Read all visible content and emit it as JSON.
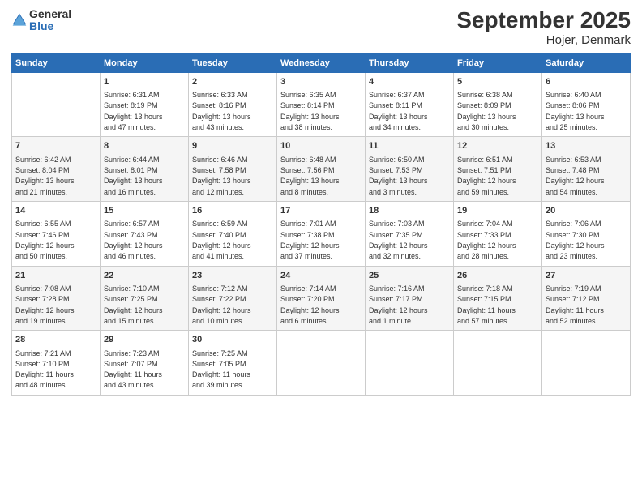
{
  "header": {
    "logo_general": "General",
    "logo_blue": "Blue",
    "title": "September 2025",
    "subtitle": "Hojer, Denmark"
  },
  "days_of_week": [
    "Sunday",
    "Monday",
    "Tuesday",
    "Wednesday",
    "Thursday",
    "Friday",
    "Saturday"
  ],
  "weeks": [
    [
      {
        "day": "",
        "info": ""
      },
      {
        "day": "1",
        "info": "Sunrise: 6:31 AM\nSunset: 8:19 PM\nDaylight: 13 hours\nand 47 minutes."
      },
      {
        "day": "2",
        "info": "Sunrise: 6:33 AM\nSunset: 8:16 PM\nDaylight: 13 hours\nand 43 minutes."
      },
      {
        "day": "3",
        "info": "Sunrise: 6:35 AM\nSunset: 8:14 PM\nDaylight: 13 hours\nand 38 minutes."
      },
      {
        "day": "4",
        "info": "Sunrise: 6:37 AM\nSunset: 8:11 PM\nDaylight: 13 hours\nand 34 minutes."
      },
      {
        "day": "5",
        "info": "Sunrise: 6:38 AM\nSunset: 8:09 PM\nDaylight: 13 hours\nand 30 minutes."
      },
      {
        "day": "6",
        "info": "Sunrise: 6:40 AM\nSunset: 8:06 PM\nDaylight: 13 hours\nand 25 minutes."
      }
    ],
    [
      {
        "day": "7",
        "info": "Sunrise: 6:42 AM\nSunset: 8:04 PM\nDaylight: 13 hours\nand 21 minutes."
      },
      {
        "day": "8",
        "info": "Sunrise: 6:44 AM\nSunset: 8:01 PM\nDaylight: 13 hours\nand 16 minutes."
      },
      {
        "day": "9",
        "info": "Sunrise: 6:46 AM\nSunset: 7:58 PM\nDaylight: 13 hours\nand 12 minutes."
      },
      {
        "day": "10",
        "info": "Sunrise: 6:48 AM\nSunset: 7:56 PM\nDaylight: 13 hours\nand 8 minutes."
      },
      {
        "day": "11",
        "info": "Sunrise: 6:50 AM\nSunset: 7:53 PM\nDaylight: 13 hours\nand 3 minutes."
      },
      {
        "day": "12",
        "info": "Sunrise: 6:51 AM\nSunset: 7:51 PM\nDaylight: 12 hours\nand 59 minutes."
      },
      {
        "day": "13",
        "info": "Sunrise: 6:53 AM\nSunset: 7:48 PM\nDaylight: 12 hours\nand 54 minutes."
      }
    ],
    [
      {
        "day": "14",
        "info": "Sunrise: 6:55 AM\nSunset: 7:46 PM\nDaylight: 12 hours\nand 50 minutes."
      },
      {
        "day": "15",
        "info": "Sunrise: 6:57 AM\nSunset: 7:43 PM\nDaylight: 12 hours\nand 46 minutes."
      },
      {
        "day": "16",
        "info": "Sunrise: 6:59 AM\nSunset: 7:40 PM\nDaylight: 12 hours\nand 41 minutes."
      },
      {
        "day": "17",
        "info": "Sunrise: 7:01 AM\nSunset: 7:38 PM\nDaylight: 12 hours\nand 37 minutes."
      },
      {
        "day": "18",
        "info": "Sunrise: 7:03 AM\nSunset: 7:35 PM\nDaylight: 12 hours\nand 32 minutes."
      },
      {
        "day": "19",
        "info": "Sunrise: 7:04 AM\nSunset: 7:33 PM\nDaylight: 12 hours\nand 28 minutes."
      },
      {
        "day": "20",
        "info": "Sunrise: 7:06 AM\nSunset: 7:30 PM\nDaylight: 12 hours\nand 23 minutes."
      }
    ],
    [
      {
        "day": "21",
        "info": "Sunrise: 7:08 AM\nSunset: 7:28 PM\nDaylight: 12 hours\nand 19 minutes."
      },
      {
        "day": "22",
        "info": "Sunrise: 7:10 AM\nSunset: 7:25 PM\nDaylight: 12 hours\nand 15 minutes."
      },
      {
        "day": "23",
        "info": "Sunrise: 7:12 AM\nSunset: 7:22 PM\nDaylight: 12 hours\nand 10 minutes."
      },
      {
        "day": "24",
        "info": "Sunrise: 7:14 AM\nSunset: 7:20 PM\nDaylight: 12 hours\nand 6 minutes."
      },
      {
        "day": "25",
        "info": "Sunrise: 7:16 AM\nSunset: 7:17 PM\nDaylight: 12 hours\nand 1 minute."
      },
      {
        "day": "26",
        "info": "Sunrise: 7:18 AM\nSunset: 7:15 PM\nDaylight: 11 hours\nand 57 minutes."
      },
      {
        "day": "27",
        "info": "Sunrise: 7:19 AM\nSunset: 7:12 PM\nDaylight: 11 hours\nand 52 minutes."
      }
    ],
    [
      {
        "day": "28",
        "info": "Sunrise: 7:21 AM\nSunset: 7:10 PM\nDaylight: 11 hours\nand 48 minutes."
      },
      {
        "day": "29",
        "info": "Sunrise: 7:23 AM\nSunset: 7:07 PM\nDaylight: 11 hours\nand 43 minutes."
      },
      {
        "day": "30",
        "info": "Sunrise: 7:25 AM\nSunset: 7:05 PM\nDaylight: 11 hours\nand 39 minutes."
      },
      {
        "day": "",
        "info": ""
      },
      {
        "day": "",
        "info": ""
      },
      {
        "day": "",
        "info": ""
      },
      {
        "day": "",
        "info": ""
      }
    ]
  ]
}
